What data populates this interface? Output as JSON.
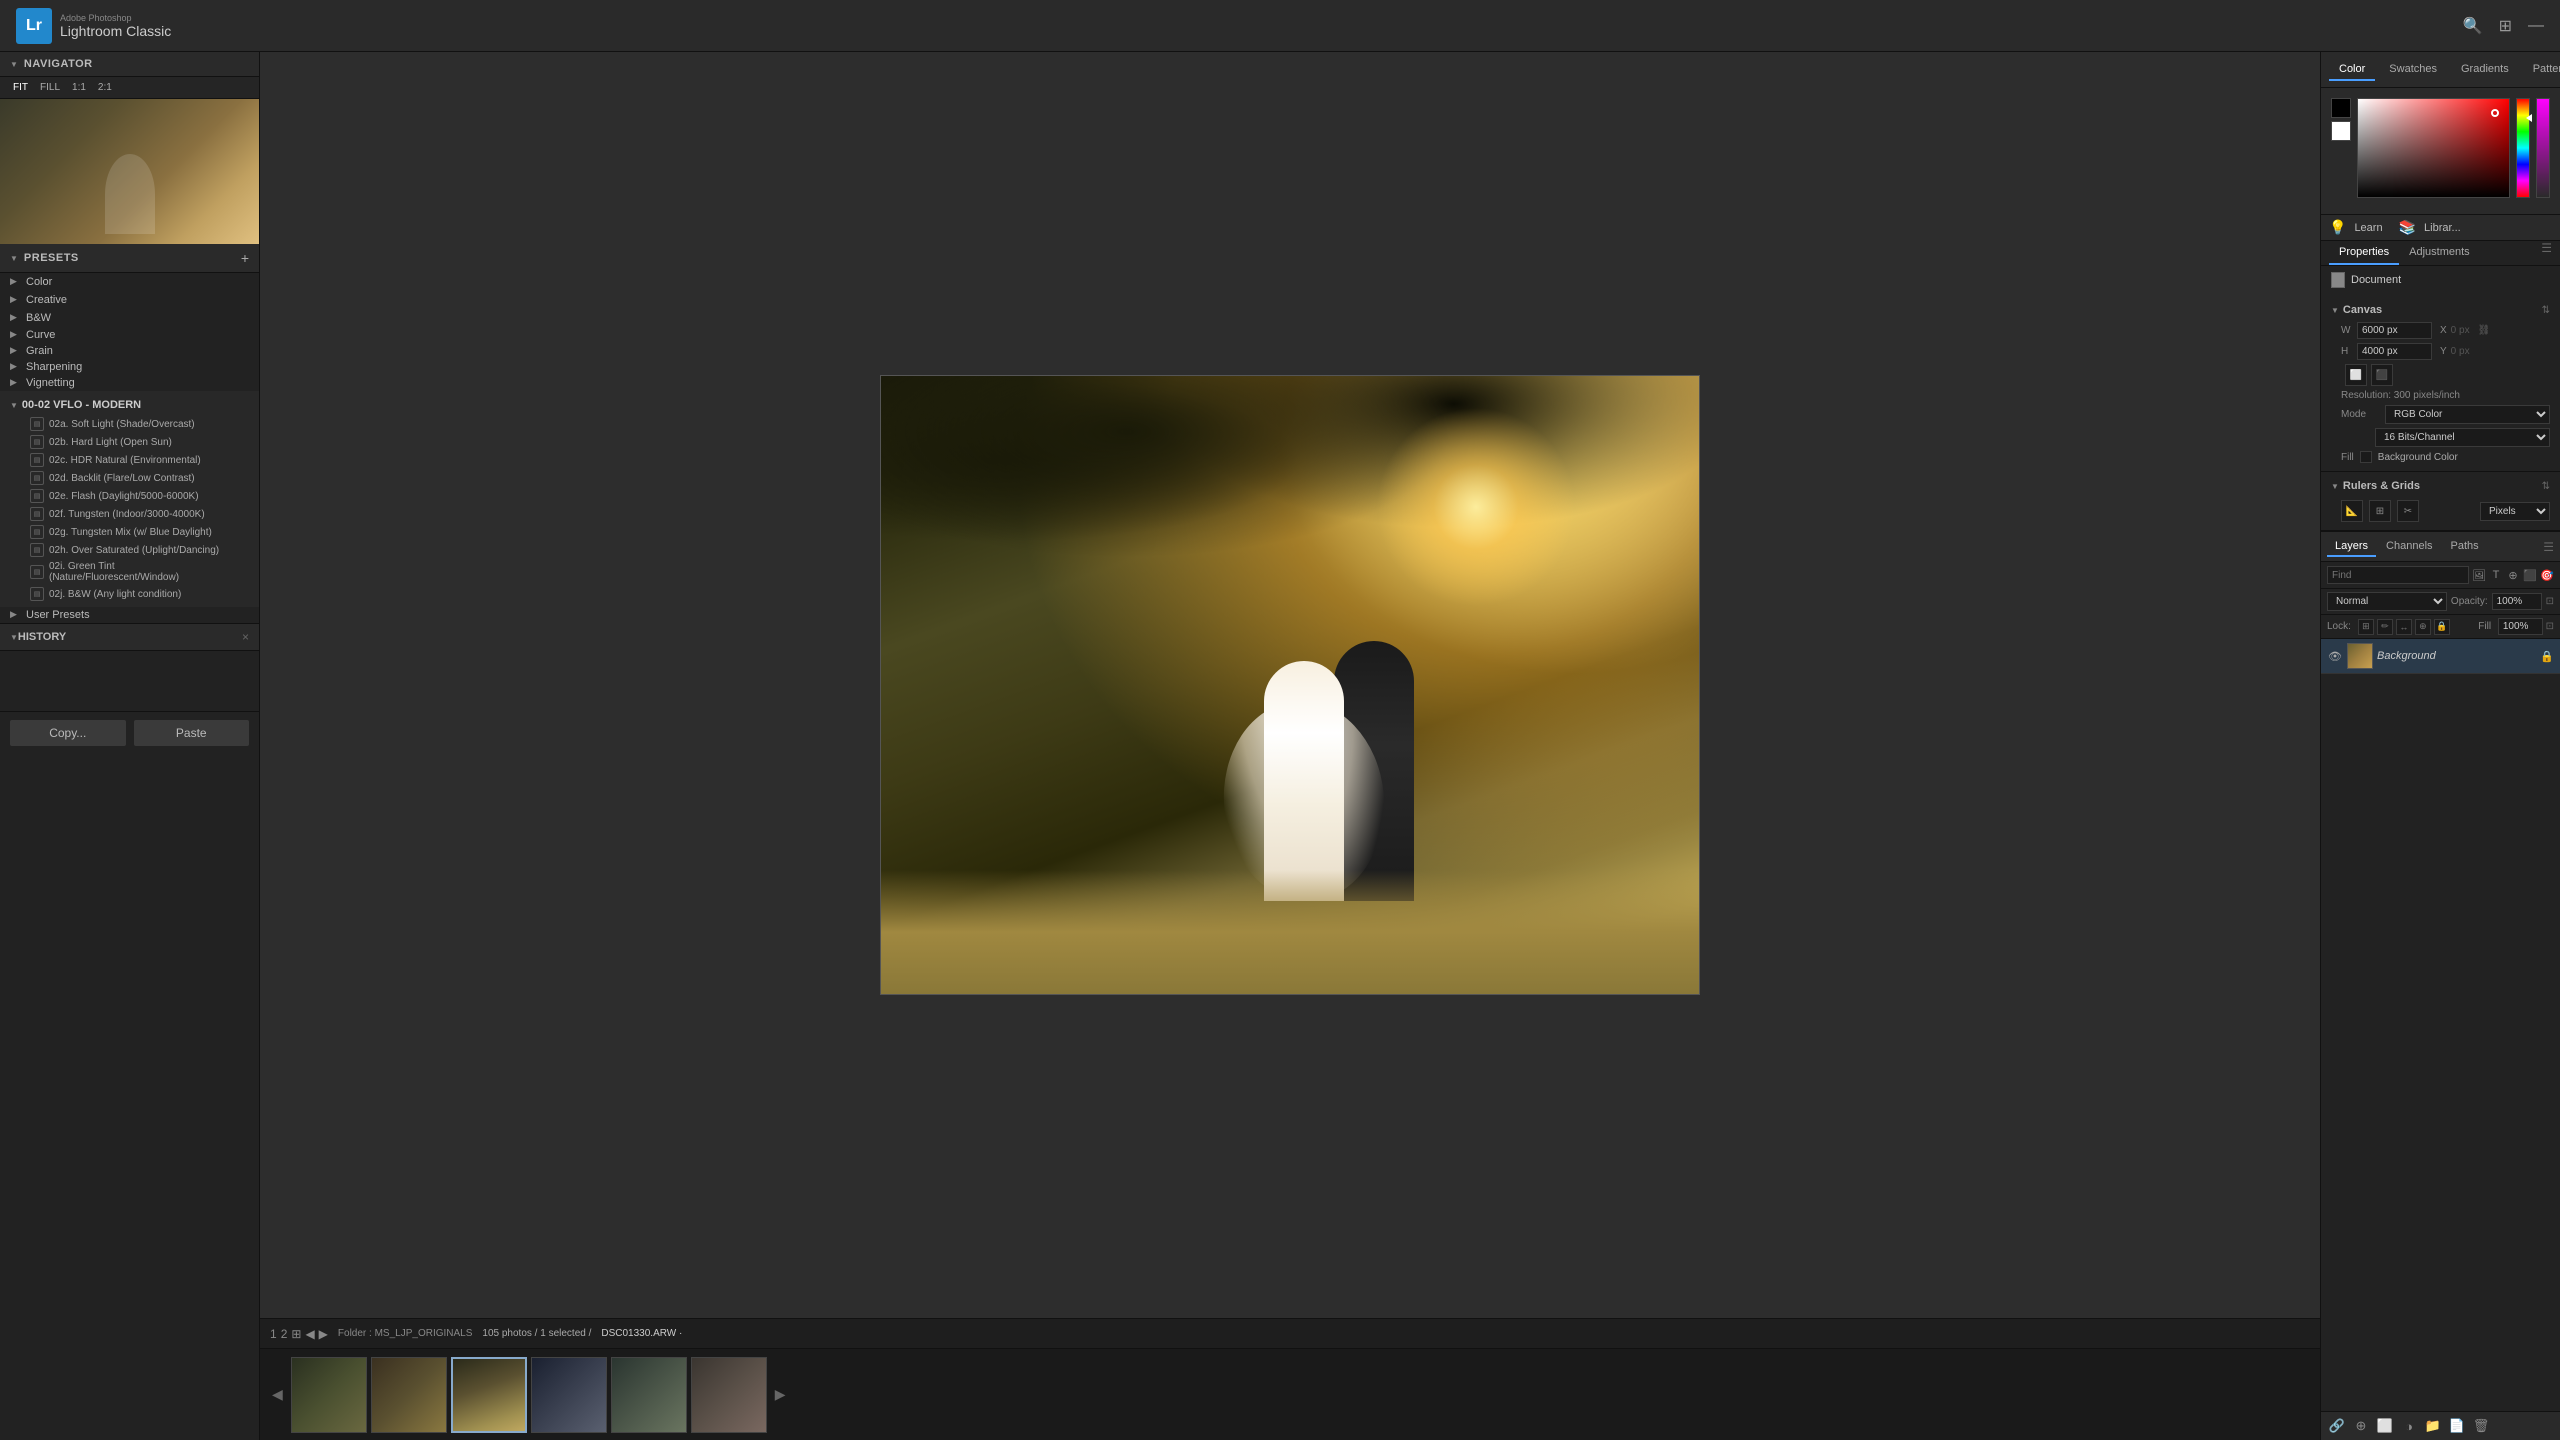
{
  "app": {
    "adobe_label": "Adobe Photoshop",
    "name": "Lightroom Classic"
  },
  "top_bar": {
    "zoom_levels": [
      "FIT",
      "FILL",
      "1:1",
      "2:1"
    ]
  },
  "navigator": {
    "title": "Navigator"
  },
  "presets": {
    "title": "Presets",
    "add_label": "+",
    "groups": [
      {
        "label": "Color",
        "type": "group"
      },
      {
        "label": "Creative",
        "type": "group"
      },
      {
        "label": "B&W",
        "type": "group"
      },
      {
        "label": "Curve",
        "type": "folder"
      },
      {
        "label": "Grain",
        "type": "folder"
      },
      {
        "label": "Sharpening",
        "type": "folder"
      },
      {
        "label": "Vignetting",
        "type": "folder"
      }
    ],
    "main_group": {
      "label": "00-02 VFLO - MODERN",
      "items": [
        "02a. Soft Light (Shade/Overcast)",
        "02b. Hard Light (Open Sun)",
        "02c. HDR Natural (Environmental)",
        "02d. Backlit (Flare/Low Contrast)",
        "02e. Flash (Daylight/5000-6000K)",
        "02f. Tungsten (Indoor/3000-4000K)",
        "02g. Tungsten Mix (w/ Blue Daylight)",
        "02h. Over Saturated (Uplight/Dancing)",
        "02i. Green Tint (Nature/Fluorescent/Window)",
        "02j. B&W (Any light condition)"
      ]
    },
    "user_presets": "User Presets"
  },
  "history": {
    "title": "History",
    "close_btn": "×"
  },
  "copy_btn": "Copy...",
  "paste_btn": "Paste",
  "status": {
    "folder_label": "Folder : MS_LJP_ORIGINALS",
    "count": "105 photos / 1 selected /",
    "filename": "DSC01330.ARW ·"
  },
  "ps_tabs": {
    "color": "Color",
    "swatches": "Swatches",
    "gradients": "Gradients",
    "patterns": "Patterns",
    "learn": "Learn"
  },
  "properties": {
    "tab_properties": "Properties",
    "tab_adjustments": "Adjustments",
    "doc_label": "Document",
    "canvas_title": "Canvas",
    "width_label": "W",
    "height_label": "H",
    "width_value": "6000 px",
    "height_value": "4000 px",
    "x_label": "X",
    "y_label": "Y",
    "x_value": "",
    "y_value": "",
    "resolution": "Resolution: 300 pixels/inch",
    "mode_label": "Mode",
    "mode_value": "RGB Color",
    "bit_depth": "16 Bits/Channel",
    "fill_label": "Fill",
    "fill_bg_label": "Background Color"
  },
  "rulers": {
    "title": "Rulers & Grids",
    "unit": "Pixels"
  },
  "layers": {
    "tab_layers": "Layers",
    "tab_channels": "Channels",
    "tab_paths": "Paths",
    "blend_mode": "Normal",
    "opacity_label": "Opacity:",
    "opacity_value": "100%",
    "lock_label": "Lock:",
    "fill_label": "Fill",
    "fill_value": "100%",
    "layer_name": "Background",
    "search_placeholder": "Find"
  }
}
